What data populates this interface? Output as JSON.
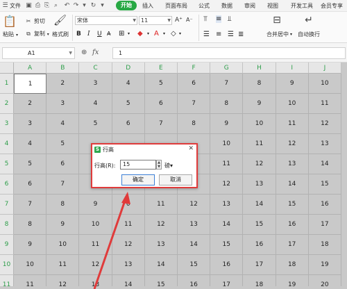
{
  "menu": {
    "items": [
      "文件",
      "开始",
      "插入",
      "页面布局",
      "公式",
      "数据",
      "审阅",
      "视图",
      "开发工具",
      "会员专享"
    ],
    "active": "开始"
  },
  "ribbon": {
    "paste": "粘贴",
    "cut": "剪切",
    "copy": "复制",
    "format_painter": "格式刷",
    "font_name": "宋体",
    "font_size": "11",
    "merge_center": "合并居中",
    "wrap_text": "自动换行"
  },
  "formula_bar": {
    "name_box": "A1",
    "fx": "fx",
    "value": "1"
  },
  "columns": [
    "A",
    "B",
    "C",
    "D",
    "E",
    "F",
    "G",
    "H",
    "I",
    "J"
  ],
  "rows": [
    {
      "num": "1",
      "cells": [
        "1",
        "2",
        "3",
        "4",
        "5",
        "6",
        "7",
        "8",
        "9",
        "10"
      ]
    },
    {
      "num": "2",
      "cells": [
        "2",
        "3",
        "4",
        "5",
        "6",
        "7",
        "8",
        "9",
        "10",
        "11"
      ]
    },
    {
      "num": "3",
      "cells": [
        "3",
        "4",
        "5",
        "6",
        "7",
        "8",
        "9",
        "10",
        "11",
        "12"
      ]
    },
    {
      "num": "4",
      "cells": [
        "4",
        "5",
        "",
        "",
        "",
        "",
        "10",
        "11",
        "12",
        "13"
      ]
    },
    {
      "num": "5",
      "cells": [
        "5",
        "6",
        "",
        "",
        "",
        "",
        "11",
        "12",
        "13",
        "14"
      ]
    },
    {
      "num": "6",
      "cells": [
        "6",
        "7",
        "",
        "",
        "",
        "",
        "12",
        "13",
        "14",
        "15"
      ]
    },
    {
      "num": "7",
      "cells": [
        "7",
        "8",
        "9",
        "0",
        "11",
        "12",
        "13",
        "14",
        "15",
        "16"
      ]
    },
    {
      "num": "8",
      "cells": [
        "8",
        "9",
        "10",
        "11",
        "12",
        "13",
        "14",
        "15",
        "16",
        "17"
      ]
    },
    {
      "num": "9",
      "cells": [
        "9",
        "10",
        "11",
        "12",
        "13",
        "14",
        "15",
        "16",
        "17",
        "18"
      ]
    },
    {
      "num": "10",
      "cells": [
        "10",
        "11",
        "12",
        "13",
        "14",
        "15",
        "16",
        "17",
        "18",
        "19"
      ]
    },
    {
      "num": "11",
      "cells": [
        "11",
        "12",
        "13",
        "14",
        "15",
        "16",
        "17",
        "18",
        "19",
        "20"
      ]
    }
  ],
  "dialog": {
    "logo": "S",
    "title": "行高",
    "close": "✕",
    "label": "行高(R):",
    "value": "15",
    "unit": "磅▾",
    "ok": "确定",
    "cancel": "取消"
  },
  "colors": {
    "accent_green": "#27a843",
    "header_text": "#2e9e4a",
    "highlight_red": "#e03b3b"
  }
}
